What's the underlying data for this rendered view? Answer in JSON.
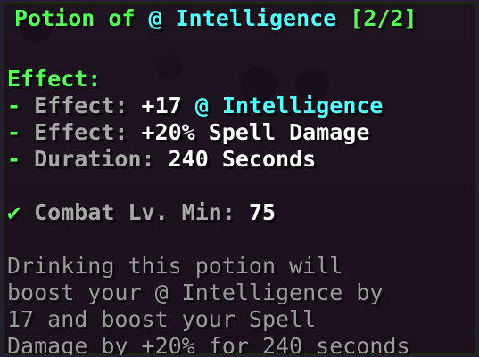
{
  "title": {
    "prefix": "Potion of ",
    "stat_icon": "@",
    "stat_name": " Intelligence",
    "count": " [2/2]"
  },
  "effect_header": "Effect:",
  "effects": [
    {
      "bullet": "- ",
      "label": "Effect: ",
      "value": "+17 ",
      "icon": "@",
      "stat": " Intelligence"
    },
    {
      "bullet": "- ",
      "label": "Effect: ",
      "value": "+20% Spell Damage"
    },
    {
      "bullet": "- ",
      "label": "Duration: ",
      "value": "240 Seconds"
    }
  ],
  "requirement": {
    "check_icon": "✔",
    "label": " Combat Lv. Min: ",
    "value": "75"
  },
  "description": [
    "Drinking this potion will",
    "boost your @ Intelligence by",
    "17 and boost your Spell",
    "Damage by +20% for 240 seconds"
  ],
  "colors": {
    "title": "#55ff55",
    "stat": "#55ffff",
    "text": "#ffffff",
    "label": "#a8a8a8",
    "description": "#9a9a9a"
  }
}
